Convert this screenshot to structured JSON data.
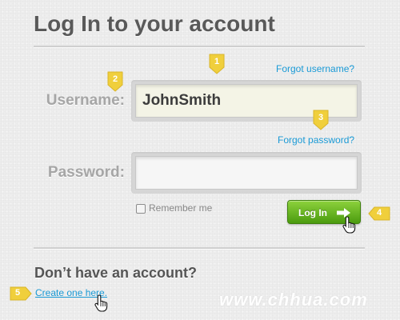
{
  "page_title": "Log In to your account",
  "form": {
    "forgot_username": "Forgot username?",
    "forgot_password": "Forgot password?",
    "username_label": "Username:",
    "username_value": "JohnSmith",
    "password_label": "Password:",
    "password_value": "",
    "remember_label": "Remember me",
    "login_button": "Log In"
  },
  "signup": {
    "heading": "Don’t have an account?",
    "link": "Create one here."
  },
  "callouts": [
    "1",
    "2",
    "3",
    "4",
    "5"
  ],
  "watermark": "www.chhua.com",
  "colors": {
    "marker": "#f0cf3c",
    "link": "#1a9ad6",
    "button_top": "#8dd23c",
    "button_bottom": "#4b9b0f"
  },
  "icons": [
    "arrow-right-icon",
    "hand-cursor-icon",
    "checkbox-icon"
  ]
}
